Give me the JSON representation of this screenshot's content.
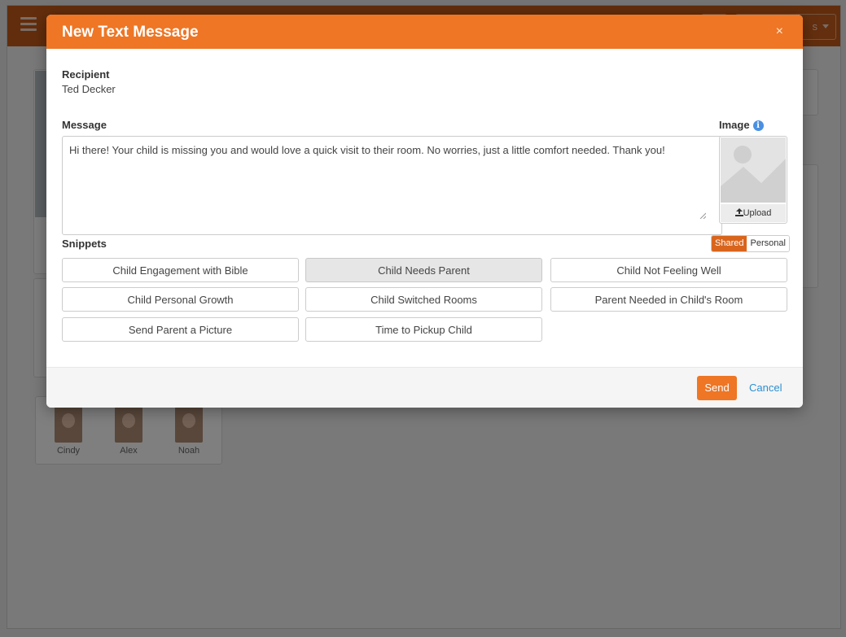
{
  "modal": {
    "title": "New Text Message",
    "close_icon": "×",
    "recipient_label": "Recipient",
    "recipient_value": "Ted Decker",
    "message_label": "Message",
    "message_value": "Hi there! Your child is missing you and would love a quick visit to their room. No worries, just a little comfort needed. Thank you!",
    "image_label": "Image",
    "info_glyph": "i",
    "upload_label": "Upload",
    "snippets_label": "Snippets",
    "toggle": {
      "shared": "Shared",
      "personal": "Personal",
      "active": "shared"
    },
    "snippets": [
      "Child Engagement with Bible",
      "Child Needs Parent",
      "Child Not Feeling Well",
      "Child Personal Growth",
      "Child Switched Rooms",
      "Parent Needed in Child's Room",
      "Send Parent a Picture",
      "Time to Pickup Child"
    ],
    "selected_snippet": "Child Needs Parent",
    "send_label": "Send",
    "cancel_label": "Cancel"
  },
  "background": {
    "topbar_color": "#c45a18",
    "topbar_partial_text": "s",
    "children": [
      "Cindy",
      "Alex",
      "Noah"
    ]
  },
  "colors": {
    "accent": "#ee7625",
    "link": "#2a8fd1",
    "info": "#4a90e2"
  },
  "icons": {
    "menu": "hamburger-icon",
    "close": "close-icon",
    "upload": "upload-icon",
    "info": "info-icon",
    "placeholder": "image-placeholder-icon"
  }
}
